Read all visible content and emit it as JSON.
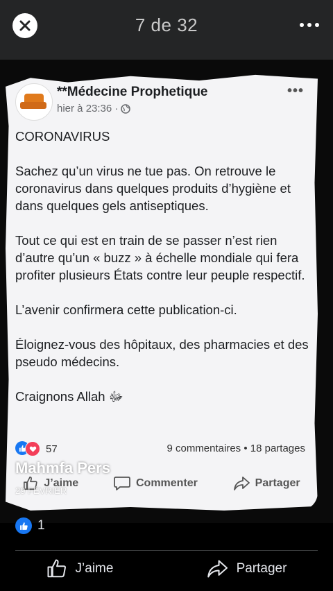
{
  "viewer": {
    "counter": "7 de 32",
    "icons": {
      "close": "close-icon",
      "more": "more-icon"
    }
  },
  "post": {
    "page_name": "**Médecine Prophetique",
    "time": "hier à 23:36 ·",
    "body": [
      "CORONAVIRUS",
      "Sachez qu’un virus ne tue pas. On retrouve le coronavirus dans quelques produits d’hygiène et dans quelques gels antiseptiques.",
      "Tout ce qui est en train de se passer n’est rien d’autre qu’un « buzz » à échelle mondiale qui fera profiter plusieurs États contre leur peuple respectif.",
      "L’avenir confirmera cette publication-ci.",
      "Éloignez-vous des hôpitaux, des pharmacies et des pseudo médecins.",
      "Craignons Allah ﷻ"
    ],
    "reactions_count": "57",
    "stats": "9 commentaires • 18 partages",
    "actions": {
      "like": "J’aime",
      "comment": "Commenter",
      "share": "Partager"
    }
  },
  "watermark": {
    "name": "Mahmfa Pers",
    "date": "29 FÉVRIER"
  },
  "footer": {
    "likes_count": "1",
    "like_label": "J’aime",
    "share_label": "Partager"
  }
}
